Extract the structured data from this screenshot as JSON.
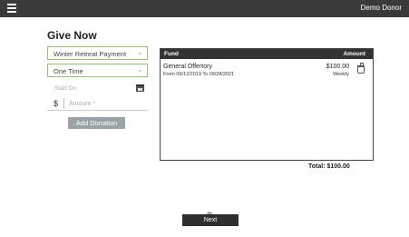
{
  "header": {
    "user_name": "Demo Donor"
  },
  "page": {
    "title": "Give Now"
  },
  "form": {
    "fund_select": "Winter Retreat Payment",
    "frequency_select": "One Time",
    "start_date_placeholder": "Start On",
    "currency_symbol": "$",
    "amount_placeholder": "Amount *",
    "add_button": "Add Donation"
  },
  "fund_table": {
    "col_fund": "Fund",
    "col_amount": "Amount",
    "rows": [
      {
        "fund": "General Offertory",
        "dates": "From 09/12/2019 To 09/28/2021",
        "amount": "$100.00",
        "frequency": "Weekly"
      }
    ],
    "total": "Total: $100.00"
  },
  "footer": {
    "next_button": "Next"
  },
  "icons": {
    "menu": "hamburger-menu-icon",
    "calendar": "calendar-icon",
    "delete": "trash-icon",
    "dropdown": "chevron-down-icon"
  },
  "colors": {
    "topbar": "#3a3a3a",
    "field_border": "#8cc96a",
    "add_button": "#9aa3a8",
    "next_button": "#2f2f2f"
  }
}
